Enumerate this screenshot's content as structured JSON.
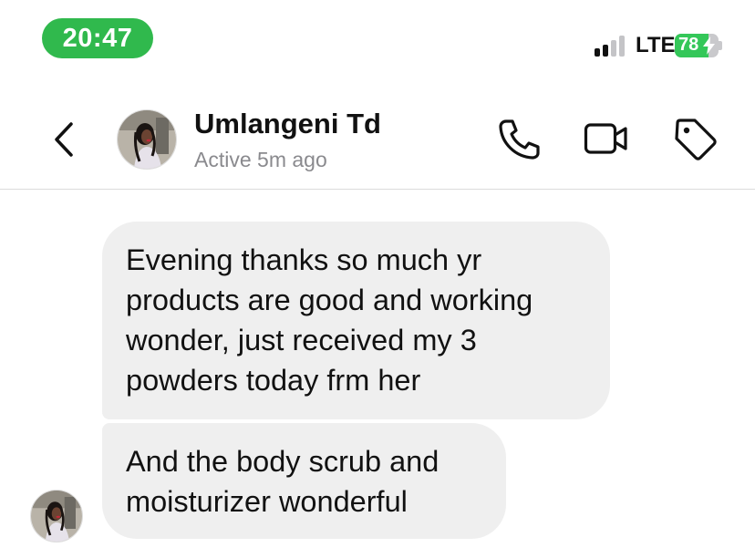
{
  "status_bar": {
    "time": "20:47",
    "network": "LTE",
    "signal_bars_active": 2,
    "signal_bars_total": 4,
    "battery_percent": "78",
    "battery_level": 0.78,
    "charging_icon": "bolt-icon"
  },
  "header": {
    "back_icon": "chevron-left-icon",
    "contact_name": "Umlangeni Td",
    "contact_status": "Active 5m ago",
    "actions": [
      {
        "name": "voice-call-button",
        "icon": "phone-icon"
      },
      {
        "name": "video-call-button",
        "icon": "video-camera-icon"
      },
      {
        "name": "label-button",
        "icon": "tag-icon"
      }
    ]
  },
  "messages": [
    {
      "sender": "contact",
      "text": "Evening thanks so much yr products are good and working wonder, just received my 3 powders today frm her"
    },
    {
      "sender": "contact",
      "text": "And the body scrub and moisturizer wonderful"
    }
  ],
  "colors": {
    "time_pill": "#30b94d",
    "battery_fill": "#34c759",
    "bubble_bg": "#efefef",
    "status_gray": "#8a8a8e"
  }
}
